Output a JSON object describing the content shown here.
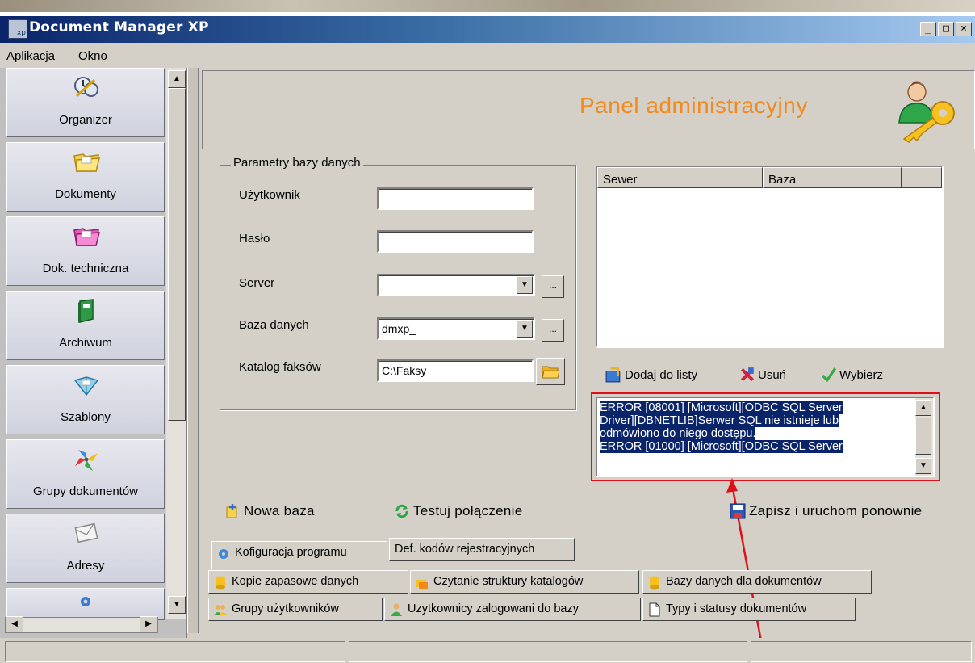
{
  "window": {
    "title": "Document Manager XP",
    "app_icon_text": "xp",
    "controls": {
      "minimize": "_",
      "maximize": "□",
      "close": "×"
    }
  },
  "menu": {
    "items": [
      "Aplikacja",
      "Okno"
    ]
  },
  "sidebar": {
    "items": [
      {
        "label": "Organizer",
        "icon": "clock-icon"
      },
      {
        "label": "Dokumenty",
        "icon": "folder-icon"
      },
      {
        "label": "Dok. techniczna",
        "icon": "pink-folder-icon"
      },
      {
        "label": "Archiwum",
        "icon": "green-book-icon"
      },
      {
        "label": "Szablony",
        "icon": "template-icon"
      },
      {
        "label": "Grupy dokumentów",
        "icon": "pinwheel-icon"
      },
      {
        "label": "Adresy",
        "icon": "envelope-icon"
      }
    ],
    "scroll_up": "▲",
    "scroll_down": "▼",
    "scroll_left": "◀",
    "scroll_right": "▶"
  },
  "header": {
    "title": "Panel administracyjny"
  },
  "db_params": {
    "legend": "Parametry bazy danych",
    "user_label": "Użytkownik",
    "user_value": "",
    "password_label": "Hasło",
    "password_value": "",
    "server_label": "Server",
    "server_value": "",
    "database_label": "Baza danych",
    "database_value": "dmxp_",
    "fax_label": "Katalog faksów",
    "fax_value": "C:\\Faksy",
    "browse_label": "...",
    "dropdown_arrow": "▼"
  },
  "server_list": {
    "columns": [
      "Sewer",
      "Baza"
    ],
    "rows": []
  },
  "list_actions": {
    "add": "Dodaj do listy",
    "remove": "Usuń",
    "choose": "Wybierz"
  },
  "error_log": {
    "lines": [
      "ERROR [08001] [Microsoft][ODBC SQL Server",
      "Driver][DBNETLIB]Serwer SQL nie istnieje lub",
      "odmówiono do niego dostępu.",
      "ERROR [01000] [Microsoft][ODBC SQL Server"
    ]
  },
  "actions": {
    "new_db": "Nowa baza",
    "test_connection": "Testuj połączenie",
    "save_restart": "Zapisz i uruchom ponownie"
  },
  "tabs": {
    "row1": [
      "Kofiguracja programu",
      "Def. kodów rejestracyjnych"
    ],
    "row2": [
      "Kopie zapasowe danych",
      "Czytanie struktury katalogów",
      "Bazy danych dla dokumentów"
    ],
    "row3": [
      "Grupy użytkowników",
      "Uzytkownicy zalogowani do bazy",
      "Typy i statusy dokumentów"
    ]
  },
  "colors": {
    "title_gradient_start": "#0a246a",
    "title_gradient_end": "#a6caf0",
    "header_title": "#f08a1c",
    "selection": "#0a246a",
    "annotation": "#e0101a"
  }
}
